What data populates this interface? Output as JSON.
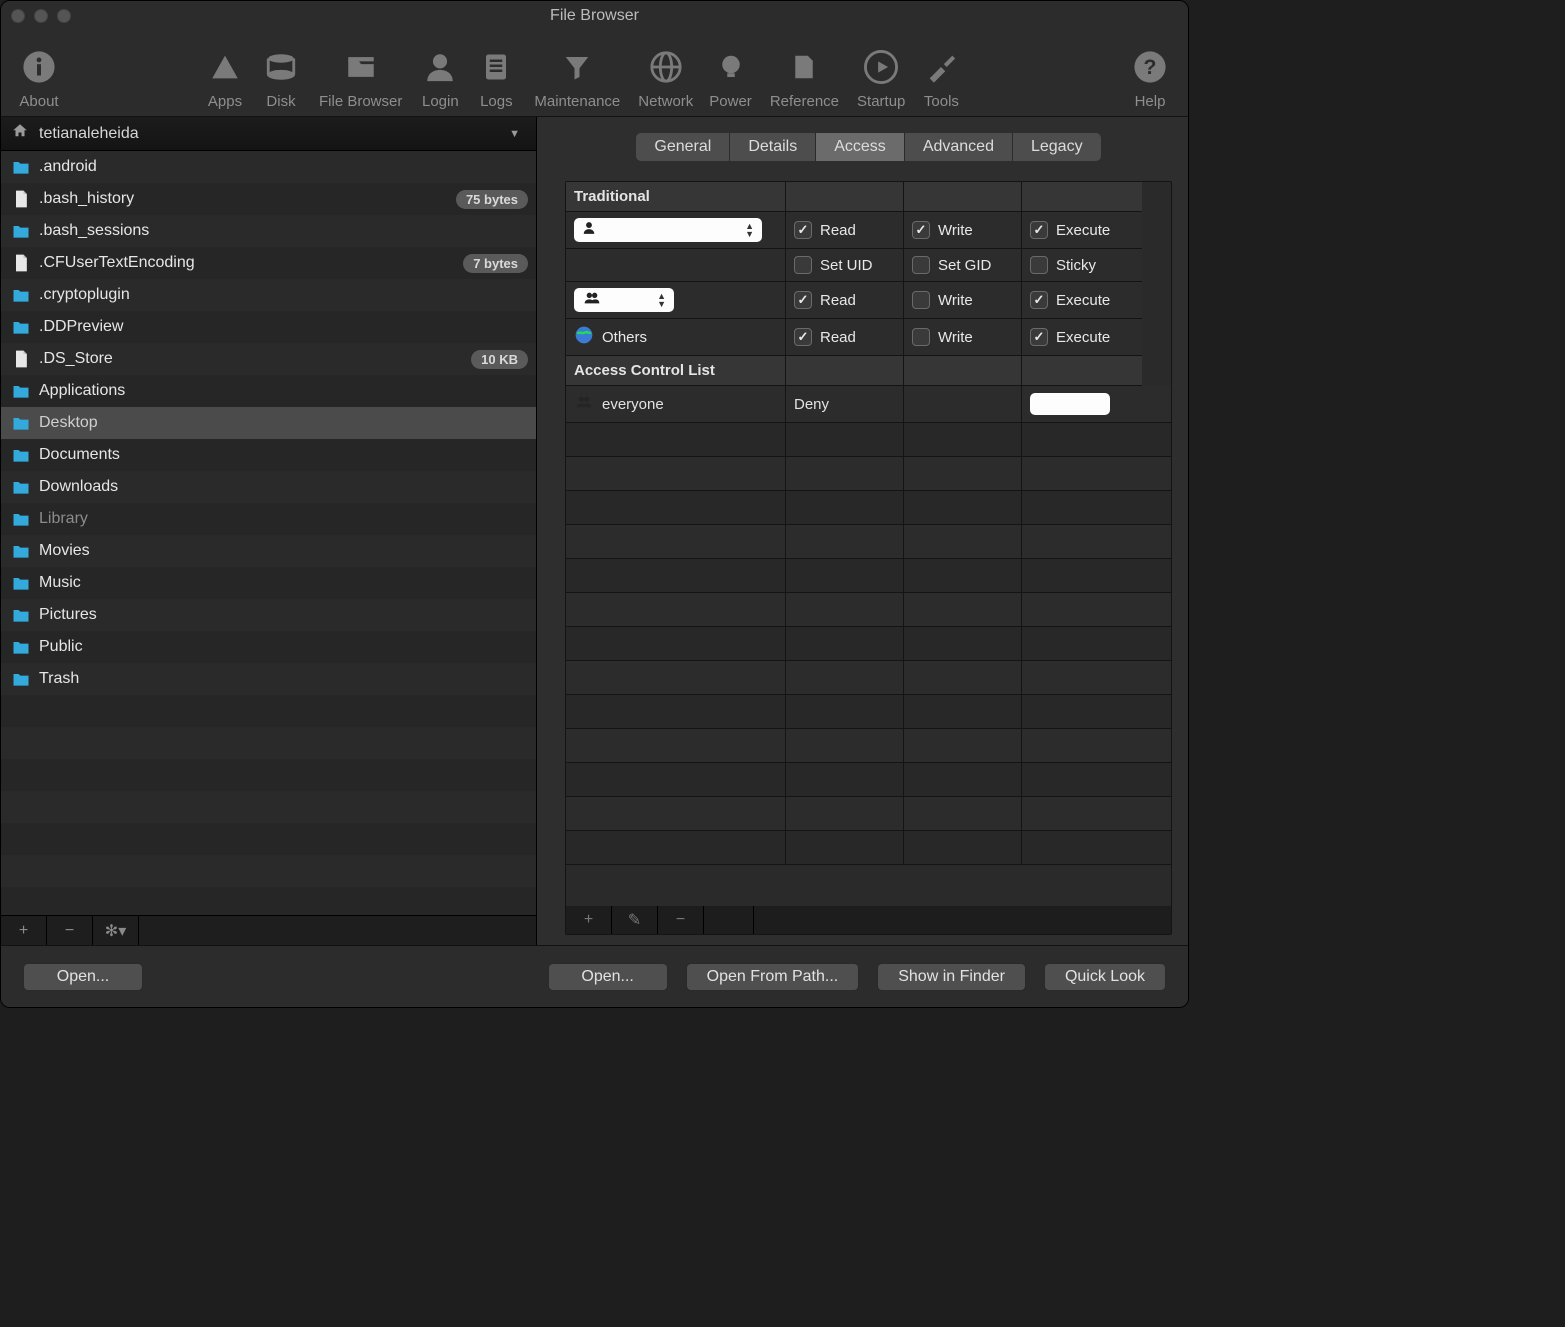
{
  "title": "File Browser",
  "toolbar": [
    {
      "id": "about",
      "label": "About"
    },
    {
      "id": "apps",
      "label": "Apps"
    },
    {
      "id": "disk",
      "label": "Disk"
    },
    {
      "id": "filebrowser",
      "label": "File Browser"
    },
    {
      "id": "login",
      "label": "Login"
    },
    {
      "id": "logs",
      "label": "Logs"
    },
    {
      "id": "maintenance",
      "label": "Maintenance"
    },
    {
      "id": "network",
      "label": "Network"
    },
    {
      "id": "power",
      "label": "Power"
    },
    {
      "id": "reference",
      "label": "Reference"
    },
    {
      "id": "startup",
      "label": "Startup"
    },
    {
      "id": "tools",
      "label": "Tools"
    },
    {
      "id": "help",
      "label": "Help"
    }
  ],
  "path": {
    "label": "tetianaleheida"
  },
  "files": [
    {
      "name": ".android",
      "type": "folder",
      "size": ""
    },
    {
      "name": ".bash_history",
      "type": "file",
      "size": "75 bytes"
    },
    {
      "name": ".bash_sessions",
      "type": "folder",
      "size": ""
    },
    {
      "name": ".CFUserTextEncoding",
      "type": "file",
      "size": "7 bytes"
    },
    {
      "name": ".cryptoplugin",
      "type": "folder",
      "size": ""
    },
    {
      "name": ".DDPreview",
      "type": "folder",
      "size": ""
    },
    {
      "name": ".DS_Store",
      "type": "file",
      "size": "10 KB"
    },
    {
      "name": "Applications",
      "type": "sysfolder",
      "size": ""
    },
    {
      "name": "Desktop",
      "type": "sysfolder",
      "size": "",
      "selected": true
    },
    {
      "name": "Documents",
      "type": "sysfolder",
      "size": ""
    },
    {
      "name": "Downloads",
      "type": "sysfolder",
      "size": ""
    },
    {
      "name": "Library",
      "type": "sysfolder",
      "size": "",
      "dim": true
    },
    {
      "name": "Movies",
      "type": "sysfolder",
      "size": ""
    },
    {
      "name": "Music",
      "type": "sysfolder",
      "size": ""
    },
    {
      "name": "Pictures",
      "type": "sysfolder",
      "size": ""
    },
    {
      "name": "Public",
      "type": "sysfolder",
      "size": ""
    },
    {
      "name": "Trash",
      "type": "folder",
      "size": ""
    }
  ],
  "tabs": [
    "General",
    "Details",
    "Access",
    "Advanced",
    "Legacy"
  ],
  "active_tab": "Access",
  "perm": {
    "traditional_hdr": "Traditional",
    "labels": {
      "read": "Read",
      "write": "Write",
      "execute": "Execute",
      "setuid": "Set UID",
      "setgid": "Set GID",
      "sticky": "Sticky",
      "others": "Others"
    },
    "owner": {
      "read": true,
      "write": true,
      "execute": true,
      "setuid": false,
      "setgid": false,
      "sticky": false
    },
    "group": {
      "read": true,
      "write": false,
      "execute": true
    },
    "others": {
      "read": true,
      "write": false,
      "execute": true
    }
  },
  "acl": {
    "hdr": "Access Control List",
    "rows": [
      {
        "who": "everyone",
        "rule": "Deny"
      }
    ]
  },
  "footer": {
    "open1": "Open...",
    "open2": "Open...",
    "open_from_path": "Open From Path...",
    "show_in_finder": "Show in Finder",
    "quick_look": "Quick Look"
  }
}
